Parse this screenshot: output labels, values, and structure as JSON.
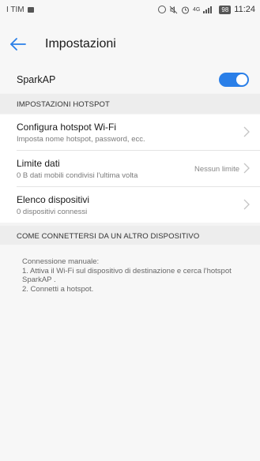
{
  "status_bar": {
    "carrier": "I TIM",
    "network": "4G",
    "battery": "98",
    "time": "11:24"
  },
  "header": {
    "title": "Impostazioni",
    "back_icon": "arrow-left-icon"
  },
  "sparkap": {
    "label": "SparkAP",
    "toggle_on": true,
    "accent_color": "#2a7fe8"
  },
  "sections": {
    "hotspot_header": "IMPOSTAZIONI HOTSPOT",
    "connect_header": "COME CONNETTERSI DA UN ALTRO DISPOSITIVO"
  },
  "items": [
    {
      "title": "Configura hotspot Wi-Fi",
      "subtitle": "Imposta nome hotspot, password, ecc.",
      "right": ""
    },
    {
      "title": "Limite dati",
      "subtitle": "0 B dati mobili condivisi l'ultima volta",
      "right": "Nessun limite"
    },
    {
      "title": "Elenco dispositivi",
      "subtitle": "0 dispositivi connessi",
      "right": ""
    }
  ],
  "instructions": {
    "line1": "Connessione manuale:",
    "line2": "1. Attiva il Wi-Fi sul dispositivo di destinazione e cerca l'hotspot SparkAP .",
    "line3": "2. Connetti a hotspot."
  }
}
